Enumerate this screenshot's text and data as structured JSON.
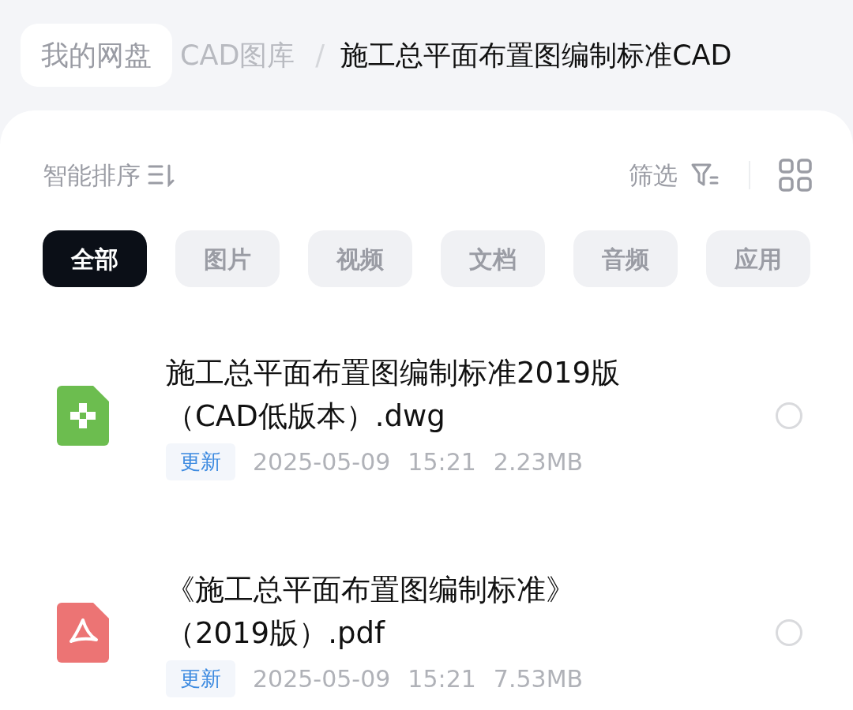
{
  "breadcrumb": [
    {
      "label": "我的网盘",
      "kind": "home"
    },
    {
      "label": "CAD图库",
      "kind": "faded"
    },
    {
      "label": "/",
      "kind": "sep"
    },
    {
      "label": "施工总平面布置图编制标准CAD",
      "kind": "current"
    }
  ],
  "toolbar": {
    "sort": "智能排序",
    "filter": "筛选"
  },
  "tabs": [
    {
      "label": "全部",
      "selected": true
    },
    {
      "label": "图片",
      "selected": false
    },
    {
      "label": "视频",
      "selected": false
    },
    {
      "label": "文档",
      "selected": false
    },
    {
      "label": "音频",
      "selected": false
    },
    {
      "label": "应用",
      "selected": false
    }
  ],
  "files": [
    {
      "kind": "dwg",
      "name": "施工总平面布置图编制标准2019版（CAD低版本）.dwg",
      "badge": "更新",
      "date": "2025-05-09",
      "time": "15:21",
      "size": "2.23MB",
      "selected": false
    },
    {
      "kind": "pdf",
      "name": "《施工总平面布置图编制标准》（2019版）.pdf",
      "badge": "更新",
      "date": "2025-05-09",
      "time": "15:21",
      "size": "7.53MB",
      "selected": false
    }
  ]
}
